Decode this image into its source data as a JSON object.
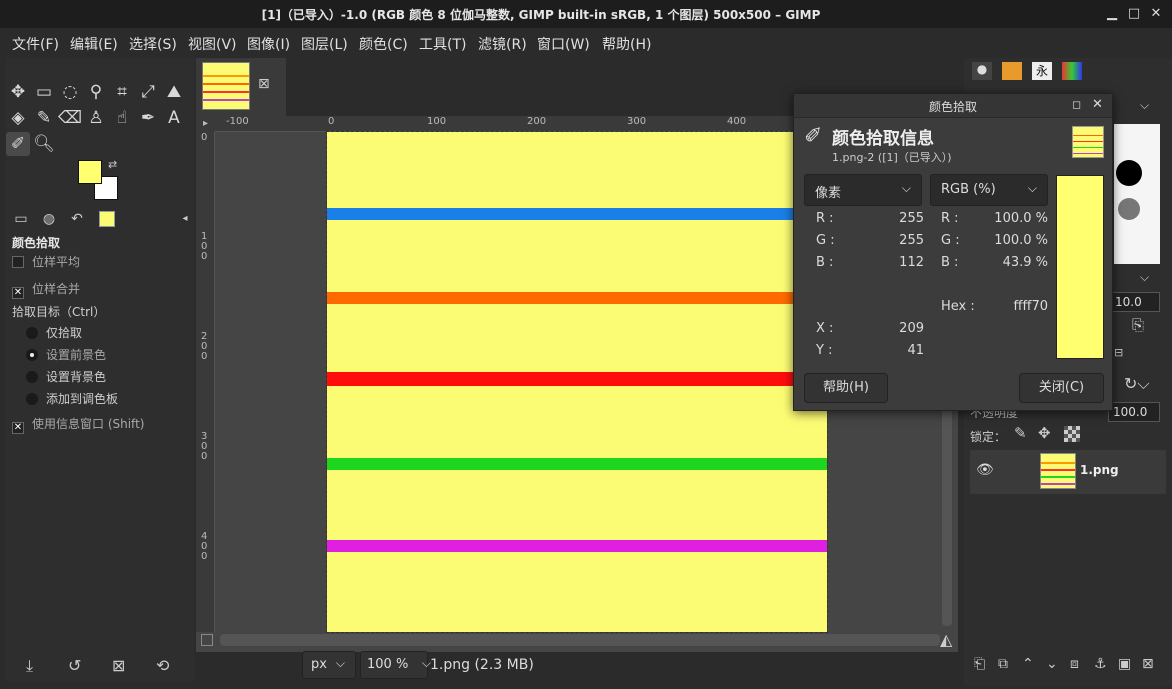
{
  "window": {
    "title": "[1]（已导入）-1.0 (RGB 颜色 8 位伽马整数, GIMP built-in sRGB, 1 个图层) 500x500 – GIMP",
    "minimize": "▁",
    "maximize": "□",
    "close": "✕"
  },
  "menu": [
    "文件(F)",
    "编辑(E)",
    "选择(S)",
    "视图(V)",
    "图像(I)",
    "图层(L)",
    "颜色(C)",
    "工具(T)",
    "滤镜(R)",
    "窗口(W)",
    "帮助(H)"
  ],
  "toolbox": {
    "options_title": "颜色拾取",
    "sample_average": "位样平均",
    "sample_merged": "位样合并",
    "pick_target_label": "拾取目标（Ctrl）",
    "targets": [
      "仅拾取",
      "设置前景色",
      "设置背景色",
      "添加到调色板"
    ],
    "selected_target": "设置前景色",
    "use_info_window": "使用信息窗口 (Shift)",
    "fg_color": "#ffff70",
    "bg_color": "#ffffff"
  },
  "canvas": {
    "ruler_h": [
      "-100",
      "0",
      "100",
      "200",
      "300",
      "400"
    ],
    "ruler_v": [
      "0",
      "1 0 0",
      "2 0 0",
      "3 0 0",
      "4 0 0"
    ],
    "background": "#fcfc74",
    "stripes": [
      "#1a7fe6",
      "#ff6a00",
      "#ff0d0d",
      "#1ed61e",
      "#e020e0"
    ]
  },
  "status": {
    "unit": "px",
    "zoom": "100 %",
    "file_info": "1.png (2.3 MB)"
  },
  "dock": {
    "brush_size": "10.0",
    "opacity_label": "不透明度",
    "opacity": "100.0",
    "lock_label": "锁定：",
    "layer_name": "1.png"
  },
  "dialog": {
    "title": "颜色拾取",
    "heading": "颜色拾取信息",
    "subtitle": "1.png-2 ([1]（已导入）)",
    "left_mode": "像素",
    "right_mode": "RGB (%)",
    "pixel": {
      "R": "255",
      "G": "255",
      "B": "112"
    },
    "percent": {
      "R": "100.0 %",
      "G": "100.0 %",
      "B": "43.9 %"
    },
    "hex_label": "Hex :",
    "hex": "ffff70",
    "x_label": "X :",
    "x": "209",
    "y_label": "Y :",
    "y": "41",
    "swatch": "#ffff70",
    "help_button": "帮助(H)",
    "close_button": "关闭(C)"
  }
}
